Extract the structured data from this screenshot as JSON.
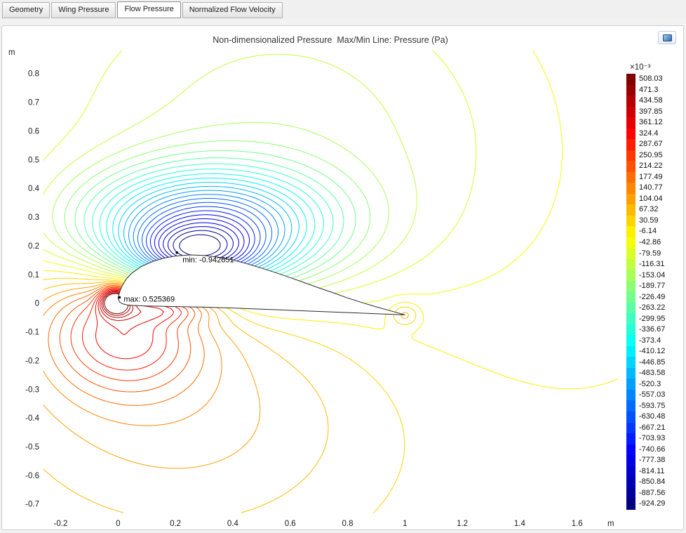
{
  "tabs": [
    {
      "label": "Geometry",
      "active": false
    },
    {
      "label": "Wing Pressure",
      "active": false
    },
    {
      "label": "Flow Pressure",
      "active": true
    },
    {
      "label": "Normalized Flow Velocity",
      "active": false
    }
  ],
  "plot": {
    "title": "Non-dimensionalized Pressure  Max/Min Line: Pressure (Pa)"
  },
  "legend": {
    "multiplier": "×10⁻³"
  },
  "chart_data": {
    "type": "contour",
    "title": "Non-dimensionalized Pressure  Max/Min Line: Pressure (Pa)",
    "x_axis": {
      "unit": "m",
      "ticks": [
        -0.2,
        0,
        0.2,
        0.4,
        0.6,
        0.8,
        1,
        1.2,
        1.4,
        1.6
      ],
      "range": [
        -0.26,
        1.74
      ]
    },
    "y_axis": {
      "unit": "m",
      "ticks": [
        0.8,
        0.7,
        0.6,
        0.5,
        0.4,
        0.3,
        0.2,
        0.1,
        0,
        -0.1,
        -0.2,
        -0.3,
        -0.4,
        -0.5,
        -0.6,
        -0.7
      ],
      "range": [
        -0.73,
        0.88
      ]
    },
    "levels_x1e3": [
      508.03,
      471.3,
      434.58,
      397.85,
      361.12,
      324.4,
      287.67,
      250.95,
      214.22,
      177.49,
      140.77,
      104.04,
      67.32,
      30.59,
      -6.14,
      -42.86,
      -79.59,
      -116.31,
      -153.04,
      -189.77,
      -226.49,
      -263.22,
      -299.95,
      -336.67,
      -373.4,
      -410.12,
      -446.85,
      -483.58,
      -520.3,
      -557.03,
      -593.75,
      -630.48,
      -667.21,
      -703.93,
      -740.66,
      -777.38,
      -814.11,
      -850.84,
      -887.56,
      -924.29
    ],
    "colormap": "rainbow: high=dark red, low=dark blue",
    "annotations": [
      {
        "label": "min: -0.942651",
        "x": 0.205,
        "y": 0.176
      },
      {
        "label": "max: 0.525369",
        "x": 0.005,
        "y": 0.02
      }
    ],
    "min": -0.942651,
    "max": 0.525369
  }
}
